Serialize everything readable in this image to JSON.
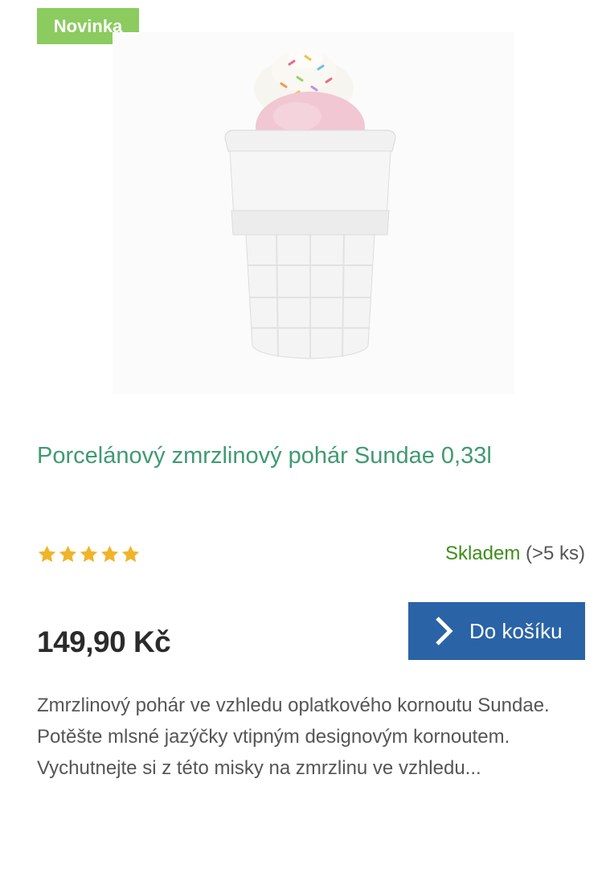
{
  "badge": {
    "label": "Novinka",
    "color": "#8bcb5f"
  },
  "product": {
    "title": "Porcelánový zmrzlinový pohár Sundae 0,33l",
    "image_icon": "ice-cream-cone-cup-image",
    "rating_stars": 5,
    "rating_max": 5,
    "stock_status": "Skladem",
    "stock_quantity": "(>5 ks)",
    "price": "149,90 Kč",
    "description": "Zmrzlinový pohár ve vzhledu oplatkového kornoutu Sundae. Potěšte mlsné jazýčky vtipným designovým kornoutem.  Vychutnejte si z této misky na zmrzlinu ve vzhledu..."
  },
  "cart_button": {
    "label": "Do košíku",
    "icon": "chevron-right-icon",
    "color": "#2a63a6"
  },
  "colors": {
    "title": "#3f9a72",
    "stock": "#3e8e1a",
    "star": "#f0b429"
  }
}
